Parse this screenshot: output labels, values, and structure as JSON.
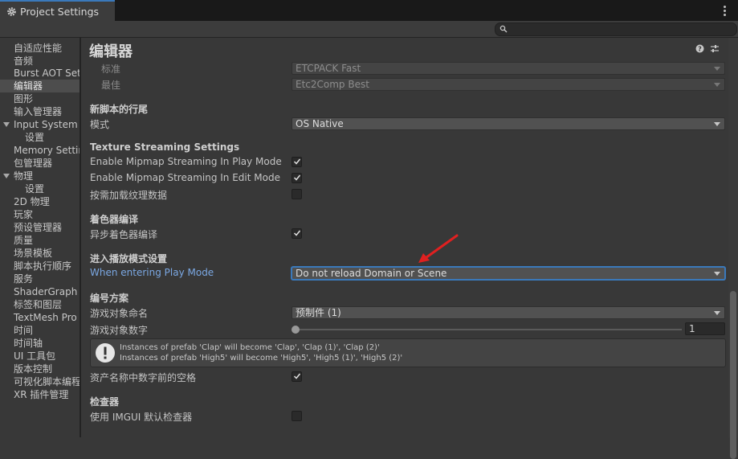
{
  "window": {
    "tab_title": "Project Settings",
    "search_placeholder": ""
  },
  "sidebar": {
    "items": [
      {
        "label": "自适应性能"
      },
      {
        "label": "音频"
      },
      {
        "label": "Burst AOT Settings"
      },
      {
        "label": "编辑器"
      },
      {
        "label": "图形"
      },
      {
        "label": "输入管理器"
      },
      {
        "label": "Input System Package"
      },
      {
        "label": "设置"
      },
      {
        "label": "Memory Settings"
      },
      {
        "label": "包管理器"
      },
      {
        "label": "物理"
      },
      {
        "label": "设置"
      },
      {
        "label": "2D 物理"
      },
      {
        "label": "玩家"
      },
      {
        "label": "预设管理器"
      },
      {
        "label": "质量"
      },
      {
        "label": "场景模板"
      },
      {
        "label": "脚本执行顺序"
      },
      {
        "label": "服务"
      },
      {
        "label": "ShaderGraph"
      },
      {
        "label": "标签和图层"
      },
      {
        "label": "TextMesh Pro"
      },
      {
        "label": "时间"
      },
      {
        "label": "时间轴"
      },
      {
        "label": "UI 工具包"
      },
      {
        "label": "版本控制"
      },
      {
        "label": "可视化脚本编程"
      },
      {
        "label": "XR 插件管理"
      }
    ]
  },
  "page": {
    "title": "编辑器",
    "etc": {
      "normal_label": "标准",
      "normal_value": "ETCPACK Fast",
      "best_label": "最佳",
      "best_value": "Etc2Comp Best"
    },
    "new_script": {
      "header": "新脚本的行尾",
      "mode_label": "模式",
      "mode_value": "OS Native"
    },
    "texture_streaming": {
      "header": "Texture Streaming Settings",
      "play_mode_label": "Enable Mipmap Streaming In Play Mode",
      "edit_mode_label": "Enable Mipmap Streaming In Edit Mode",
      "on_demand_label": "按需加载纹理数据"
    },
    "shader": {
      "header": "着色器编译",
      "async_label": "异步着色器编译"
    },
    "play_mode": {
      "header": "进入播放模式设置",
      "entering_label": "When entering Play Mode",
      "entering_value": "Do not reload Domain or Scene"
    },
    "numbering": {
      "header": "编号方案",
      "naming_label": "游戏对象命名",
      "naming_value": "预制件 (1)",
      "digits_label": "游戏对象数字",
      "digits_value": "1",
      "help_line1": "Instances of prefab 'Clap' will become 'Clap', 'Clap (1)', 'Clap (2)'",
      "help_line2": "Instances of prefab 'High5' will become 'High5', 'High5 (1)', 'High5 (2)'",
      "space_label": "资产名称中数字前的空格"
    },
    "inspector": {
      "header": "检查器",
      "imgui_label": "使用 IMGUI 默认检查器"
    }
  },
  "colors": {
    "accent": "#3a79bb",
    "link_label": "#7ba8e3",
    "annotation_arrow": "#e02020"
  }
}
